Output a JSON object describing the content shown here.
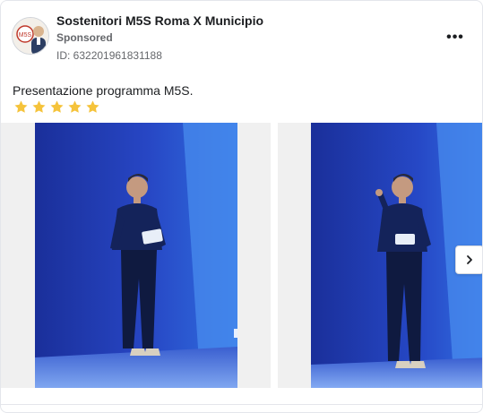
{
  "ad": {
    "page_name": "Sostenitori M5S Roma X Municipio",
    "sponsored_label": "Sponsored",
    "id_text": "ID: 632201961831188",
    "body_text": "Presentazione programma M5S.",
    "rating_stars": 5,
    "more_label": "•••"
  },
  "icons": {
    "more": "more-options-icon",
    "star": "star-icon",
    "next": "chevron-right-icon"
  },
  "colors": {
    "star": "#f5c33b",
    "stage_blue": "#1f3fb0",
    "text_secondary": "#65676b"
  },
  "carousel": {
    "slides": [
      {
        "alt": "slide-1"
      },
      {
        "alt": "slide-2"
      }
    ]
  }
}
